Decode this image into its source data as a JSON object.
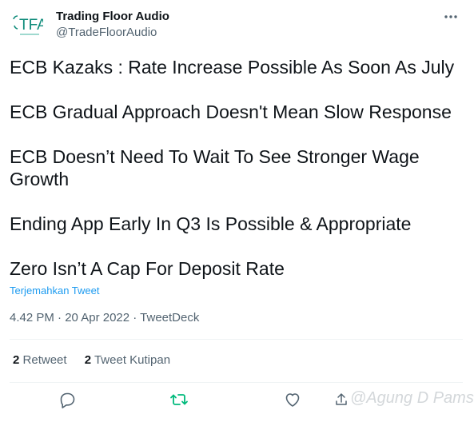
{
  "header": {
    "display_name": "Trading Floor Audio",
    "handle": "@TradeFloorAudio",
    "avatar_text": "TFA",
    "brand_color": "#0e8b7a"
  },
  "content": {
    "lines": [
      "ECB Kazaks : Rate Increase Possible As Soon As July",
      "ECB Gradual Approach Doesn't Mean Slow Response",
      "ECB Doesn’t Need To Wait To See Stronger Wage Growth",
      "Ending App Early In Q3 Is Possible & Appropriate",
      "Zero Isn’t A Cap For Deposit Rate"
    ]
  },
  "translate_label": "Terjemahkan Tweet",
  "meta": {
    "timestamp": "4.42 PM · 20 Apr 2022 · TweetDeck"
  },
  "stats": {
    "retweets_count": "2",
    "retweets_label": "Retweet",
    "quotes_count": "2",
    "quotes_label": "Tweet Kutipan"
  },
  "actions": {
    "reply_icon": "reply-icon",
    "retweet_icon": "retweet-icon",
    "like_icon": "like-icon",
    "share_icon": "share-icon",
    "retweet_color": "#00ba7c"
  },
  "watermark": "@Agung D Pams"
}
